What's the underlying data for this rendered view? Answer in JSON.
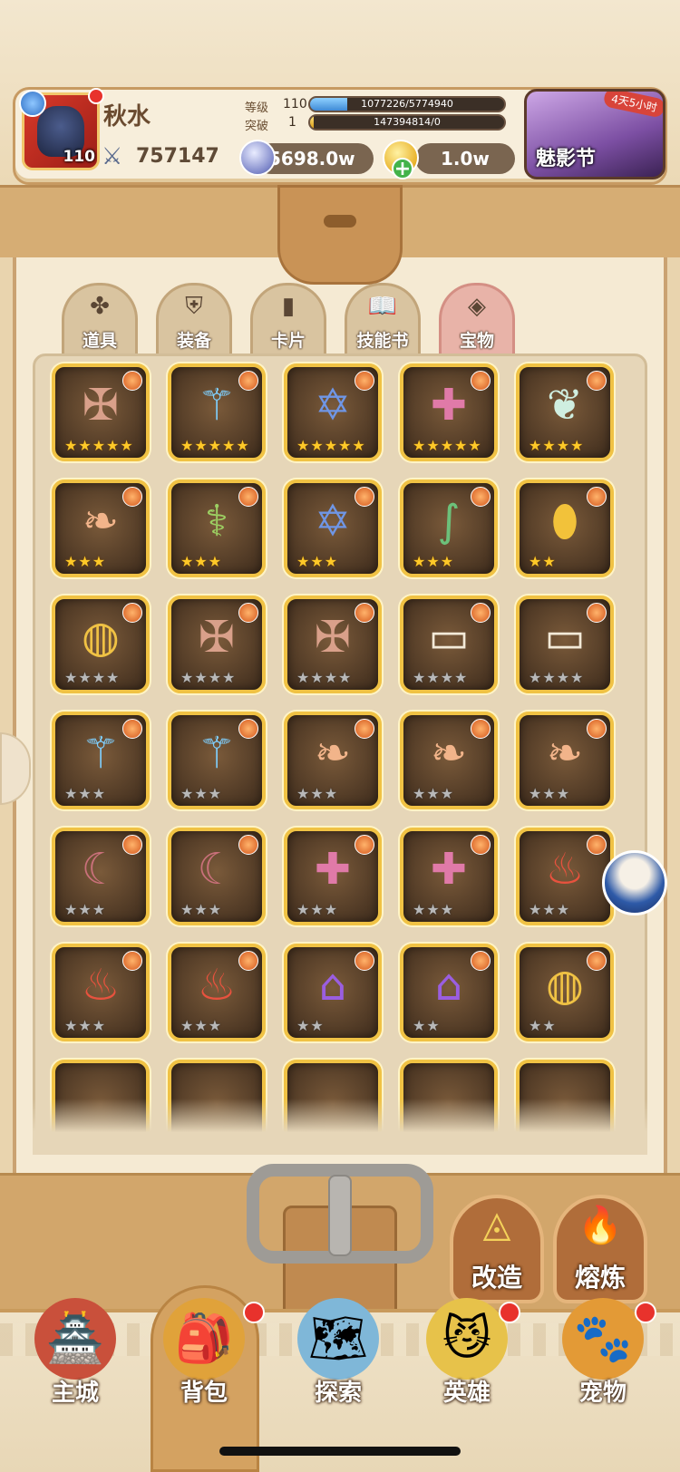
{
  "player": {
    "name": "秋水",
    "avatar_level": "110",
    "power": "757147",
    "level_label": "等级",
    "level_value": "110",
    "level_exp": "1077226/5774940",
    "level_progress": 0.19,
    "breakthrough_label": "突破",
    "breakthrough_value": "1",
    "breakthrough_exp": "147394814/0",
    "breakthrough_progress": 0.02
  },
  "currency": {
    "silver": "5698.0w",
    "gold": "1.0w"
  },
  "event": {
    "name": "魅影节",
    "timer": "4天5小时"
  },
  "tabs": [
    {
      "label": "道具",
      "icon": "clover-icon"
    },
    {
      "label": "装备",
      "icon": "armor-icon"
    },
    {
      "label": "卡片",
      "icon": "card-icon"
    },
    {
      "label": "技能书",
      "icon": "book-icon"
    },
    {
      "label": "宝物",
      "icon": "treasure-icon",
      "active": true
    }
  ],
  "items": [
    {
      "icon": "winged-cross-icon",
      "stars": 5,
      "tier": "gold"
    },
    {
      "icon": "ice-staff-icon",
      "stars": 5,
      "tier": "gold"
    },
    {
      "icon": "hexagram-icon",
      "stars": 5,
      "tier": "gold"
    },
    {
      "icon": "gem-cross-icon",
      "stars": 5,
      "tier": "gold"
    },
    {
      "icon": "feather-wing-icon",
      "stars": 4,
      "tier": "gold"
    },
    {
      "icon": "feather-icon",
      "stars": 3,
      "tier": "gold"
    },
    {
      "icon": "vine-staff-icon",
      "stars": 3,
      "tier": "gold"
    },
    {
      "icon": "hexagram-icon",
      "stars": 3,
      "tier": "gold"
    },
    {
      "icon": "serpent-staff-icon",
      "stars": 3,
      "tier": "gold"
    },
    {
      "icon": "amber-shield-icon",
      "stars": 2,
      "tier": "gold"
    },
    {
      "icon": "sapphire-ring-icon",
      "stars": 4,
      "tier": "grey"
    },
    {
      "icon": "winged-cross-icon",
      "stars": 4,
      "tier": "grey"
    },
    {
      "icon": "winged-cross-icon",
      "stars": 4,
      "tier": "grey"
    },
    {
      "icon": "open-book-icon",
      "stars": 4,
      "tier": "grey"
    },
    {
      "icon": "open-book-icon",
      "stars": 4,
      "tier": "grey"
    },
    {
      "icon": "ice-staff-icon",
      "stars": 3,
      "tier": "grey"
    },
    {
      "icon": "ice-staff-icon",
      "stars": 3,
      "tier": "grey"
    },
    {
      "icon": "feather-icon",
      "stars": 3,
      "tier": "grey"
    },
    {
      "icon": "feather-icon",
      "stars": 3,
      "tier": "grey"
    },
    {
      "icon": "feather-icon",
      "stars": 3,
      "tier": "grey"
    },
    {
      "icon": "scythe-icon",
      "stars": 3,
      "tier": "grey"
    },
    {
      "icon": "scythe-icon",
      "stars": 3,
      "tier": "grey"
    },
    {
      "icon": "gem-cross-icon",
      "stars": 3,
      "tier": "grey"
    },
    {
      "icon": "gem-cross-icon",
      "stars": 3,
      "tier": "grey"
    },
    {
      "icon": "flame-claw-icon",
      "stars": 3,
      "tier": "grey"
    },
    {
      "icon": "flame-claw-icon",
      "stars": 3,
      "tier": "grey"
    },
    {
      "icon": "flame-claw-icon",
      "stars": 3,
      "tier": "grey"
    },
    {
      "icon": "purple-bell-icon",
      "stars": 2,
      "tier": "grey"
    },
    {
      "icon": "purple-bell-icon",
      "stars": 2,
      "tier": "grey"
    },
    {
      "icon": "sapphire-ring-icon",
      "stars": 2,
      "tier": "grey"
    }
  ],
  "actions": [
    {
      "label": "改造",
      "icon": "eye-triangle-icon"
    },
    {
      "label": "熔炼",
      "icon": "furnace-flame-icon"
    }
  ],
  "nav": [
    {
      "label": "主城",
      "icon": "castle-icon",
      "badge": false
    },
    {
      "label": "背包",
      "icon": "backpack-icon",
      "badge": true,
      "active": true
    },
    {
      "label": "探索",
      "icon": "map-scroll-icon",
      "badge": false
    },
    {
      "label": "英雄",
      "icon": "hero-icon",
      "badge": true
    },
    {
      "label": "宠物",
      "icon": "pet-icon",
      "badge": true
    }
  ],
  "colors": {
    "accent_gold": "#f0c244",
    "active_tab": "#e8b3a8",
    "badge_red": "#e8322c"
  }
}
